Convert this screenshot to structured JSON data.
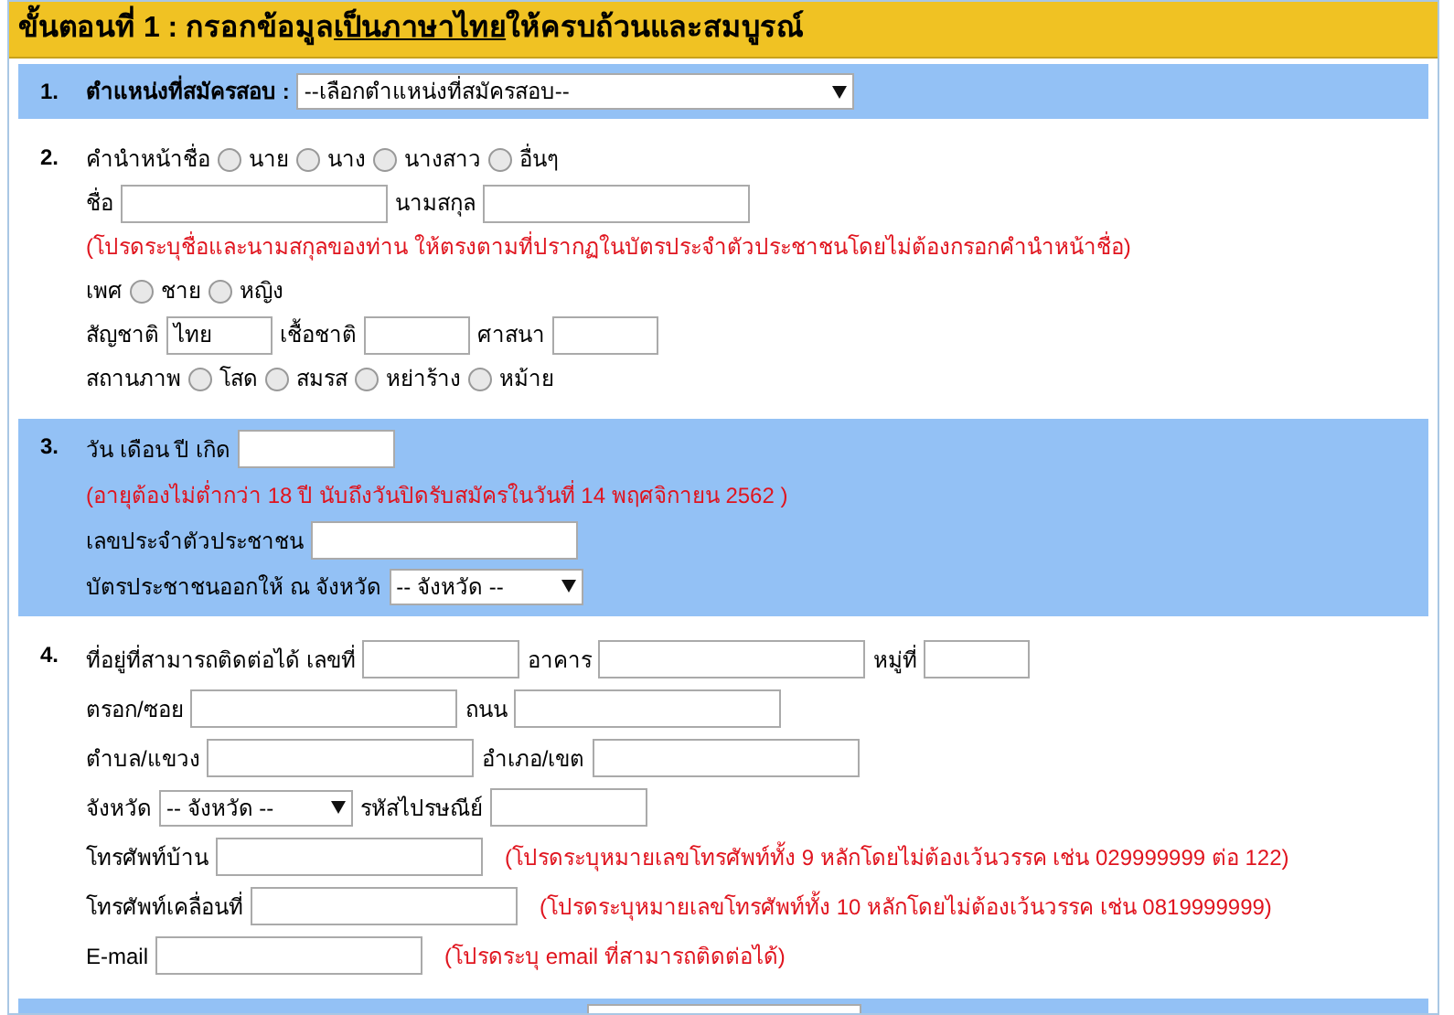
{
  "header": {
    "parts": [
      {
        "text": "ขั้นตอนที่ 1 : กรอกข้อมูล",
        "underlined": false
      },
      {
        "text": "เป็นภาษาไทย",
        "underlined": true
      },
      {
        "text": "ให้ครบถ้วนและสมบูรณ์",
        "underlined": false
      }
    ]
  },
  "sections": [
    {
      "number": "1.",
      "shaded": true,
      "rows": [
        {
          "items": [
            {
              "kind": "label",
              "text": "ตำแหน่งที่สมัครสอบ :",
              "bold": true
            },
            {
              "kind": "select",
              "value": "--เลือกตำแหน่งที่สมัครสอบ--"
            }
          ]
        }
      ]
    },
    {
      "number": "2.",
      "shaded": false,
      "rows": [
        {
          "items": [
            {
              "kind": "label",
              "text": "คำนำหน้าชื่อ"
            },
            {
              "kind": "radio",
              "label": "นาย",
              "checked": false
            },
            {
              "kind": "radio",
              "label": "นาง",
              "checked": false
            },
            {
              "kind": "radio",
              "label": "นางสาว",
              "checked": false
            },
            {
              "kind": "radio",
              "label": "อื่นๆ",
              "checked": false
            }
          ]
        },
        {
          "items": [
            {
              "kind": "label",
              "text": "ชื่อ"
            },
            {
              "kind": "input"
            },
            {
              "kind": "label",
              "text": "นามสกุล"
            },
            {
              "kind": "input"
            }
          ]
        },
        {
          "items": [
            {
              "kind": "note",
              "text": "(โปรดระบุชื่อและนามสกุลของท่าน ให้ตรงตามที่ปรากฏในบัตรประจำตัวประชาชนโดยไม่ต้องกรอกคำนำหน้าชื่อ)"
            }
          ]
        },
        {
          "items": [
            {
              "kind": "label",
              "text": "เพศ"
            },
            {
              "kind": "radio",
              "label": "ชาย",
              "checked": false
            },
            {
              "kind": "radio",
              "label": "หญิง",
              "checked": false
            }
          ]
        },
        {
          "items": [
            {
              "kind": "label",
              "text": "สัญชาติ"
            },
            {
              "kind": "tiny_input",
              "value": "ไทย"
            },
            {
              "kind": "label",
              "text": "เชื้อชาติ"
            },
            {
              "kind": "tiny_input"
            },
            {
              "kind": "label",
              "text": "ศาสนา"
            },
            {
              "kind": "tiny_input"
            }
          ]
        },
        {
          "items": [
            {
              "kind": "label",
              "text": "สถานภาพ"
            },
            {
              "kind": "radio",
              "label": "โสด",
              "checked": false
            },
            {
              "kind": "radio",
              "label": "สมรส",
              "checked": false
            },
            {
              "kind": "radio",
              "label": "หย่าร้าง",
              "checked": false
            },
            {
              "kind": "radio",
              "label": "หม้าย",
              "checked": false
            }
          ]
        }
      ]
    },
    {
      "number": "3.",
      "shaded": true,
      "rows": [
        {
          "items": [
            {
              "kind": "label",
              "text": "วัน เดือน ปี เกิด"
            },
            {
              "kind": "short_input"
            }
          ]
        },
        {
          "items": [
            {
              "kind": "note",
              "text": "(อายุต้องไม่ต่ำกว่า 18 ปี นับถึงวันปิดรับสมัครในวันที่ 14 พฤศจิกายน 2562 )"
            }
          ]
        },
        {
          "items": [
            {
              "kind": "label",
              "text": "เลขประจำตัวประชาชน"
            },
            {
              "kind": "input"
            }
          ]
        },
        {
          "items": [
            {
              "kind": "label",
              "text": "บัตรประชาชนออกให้ ณ จังหวัด"
            },
            {
              "kind": "small_select",
              "value": "-- จังหวัด --"
            }
          ]
        }
      ]
    },
    {
      "number": "4.",
      "shaded": false,
      "rows": [
        {
          "items": [
            {
              "kind": "label",
              "text": "ที่อยู่ที่สามารถติดต่อได้ เลขที่"
            },
            {
              "kind": "short_input"
            },
            {
              "kind": "label",
              "text": "อาคาร"
            },
            {
              "kind": "input"
            },
            {
              "kind": "label",
              "text": "หมู่ที่"
            },
            {
              "kind": "tiny_input"
            }
          ]
        },
        {
          "items": [
            {
              "kind": "label",
              "text": "ตรอก/ซอย"
            },
            {
              "kind": "input"
            },
            {
              "kind": "label",
              "text": "ถนน"
            },
            {
              "kind": "input"
            }
          ]
        },
        {
          "items": [
            {
              "kind": "label",
              "text": "ตำบล/แขวง"
            },
            {
              "kind": "input"
            },
            {
              "kind": "label",
              "text": "อำเภอ/เขต"
            },
            {
              "kind": "input"
            }
          ]
        },
        {
          "items": [
            {
              "kind": "label",
              "text": "จังหวัด"
            },
            {
              "kind": "small_select",
              "value": "-- จังหวัด --"
            },
            {
              "kind": "label",
              "text": "รหัสไปรษณีย์"
            },
            {
              "kind": "short_input"
            }
          ]
        },
        {
          "items": [
            {
              "kind": "label",
              "text": "โทรศัพท์บ้าน"
            },
            {
              "kind": "input"
            },
            {
              "kind": "note",
              "text": "(โปรดระบุหมายเลขโทรศัพท์ทั้ง 9 หลักโดยไม่ต้องเว้นวรรค เช่น 029999999 ต่อ 122)"
            }
          ]
        },
        {
          "items": [
            {
              "kind": "label",
              "text": "โทรศัพท์เคลื่อนที่"
            },
            {
              "kind": "input"
            },
            {
              "kind": "note",
              "text": "(โปรดระบุหมายเลขโทรศัพท์ทั้ง 10 หลักโดยไม่ต้องเว้นวรรค เช่น 0819999999)"
            }
          ]
        },
        {
          "items": [
            {
              "kind": "label",
              "text": "E-mail"
            },
            {
              "kind": "input"
            },
            {
              "kind": "note",
              "text": "(โปรดระบุ email ที่สามารถติดต่อได้)"
            }
          ]
        }
      ]
    }
  ]
}
